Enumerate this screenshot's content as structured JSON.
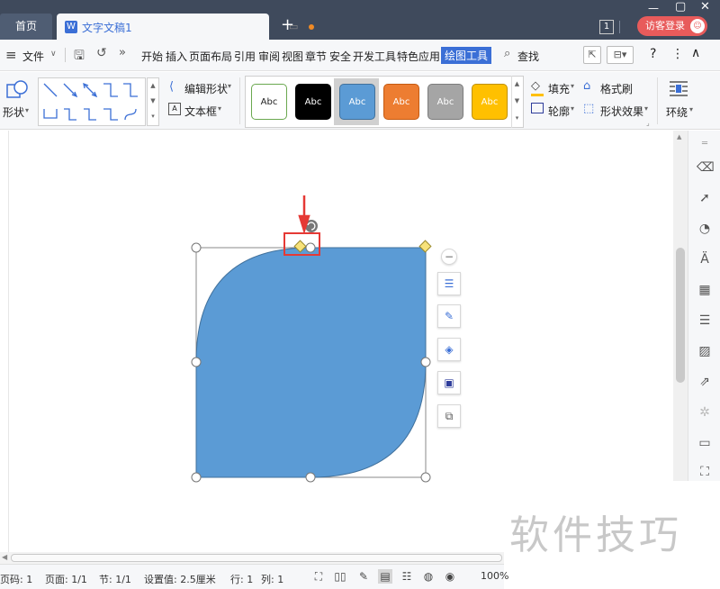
{
  "tabs": {
    "home_label": "首页",
    "doc_name": "文字文稿1",
    "doc_icon": "W",
    "new_tab": "+"
  },
  "window": {
    "badge": "1",
    "login_label": "访客登录",
    "avatar_glyph": "☺"
  },
  "menu": {
    "file_label": "文件",
    "items": [
      "开始",
      "插入",
      "页面布局",
      "引用",
      "审阅",
      "视图",
      "章节",
      "安全",
      "开发工具",
      "特色应用"
    ],
    "active": "绘图工具",
    "search_label": "查找"
  },
  "ribbon": {
    "shape_label": "形状",
    "edit_shape_label": "编辑形状",
    "textbox_label": "文本框",
    "styles": [
      {
        "label": "Abc",
        "bg": "#ffffff",
        "fg": "#222222",
        "border": "#6aa84f"
      },
      {
        "label": "Abc",
        "bg": "#000000",
        "fg": "#ffffff",
        "border": "#000000"
      },
      {
        "label": "Abc",
        "bg": "#5b9bd5",
        "fg": "#ffffff",
        "border": "#41719c"
      },
      {
        "label": "Abc",
        "bg": "#ed7d31",
        "fg": "#ffffff",
        "border": "#c55a11"
      },
      {
        "label": "Abc",
        "bg": "#a5a5a5",
        "fg": "#ffffff",
        "border": "#7c7c7c"
      },
      {
        "label": "Abc",
        "bg": "#ffc000",
        "fg": "#ffffff",
        "border": "#bf9000"
      }
    ],
    "fill_label": "填充",
    "outline_label": "轮廓",
    "format_painter_label": "格式刷",
    "shape_effect_label": "形状效果",
    "wrap_label": "环绕"
  },
  "shape": {
    "fill": "#5b9bd5",
    "stroke": "#41719c",
    "highlight_color": "#e53935"
  },
  "status": {
    "page_code": "页码: 1",
    "page": "页面: 1/1",
    "section": "节: 1/1",
    "setting": "设置值: 2.5厘米",
    "row": "行: 1",
    "col": "列: 1",
    "zoom": "100%"
  },
  "watermark": "软件技巧"
}
